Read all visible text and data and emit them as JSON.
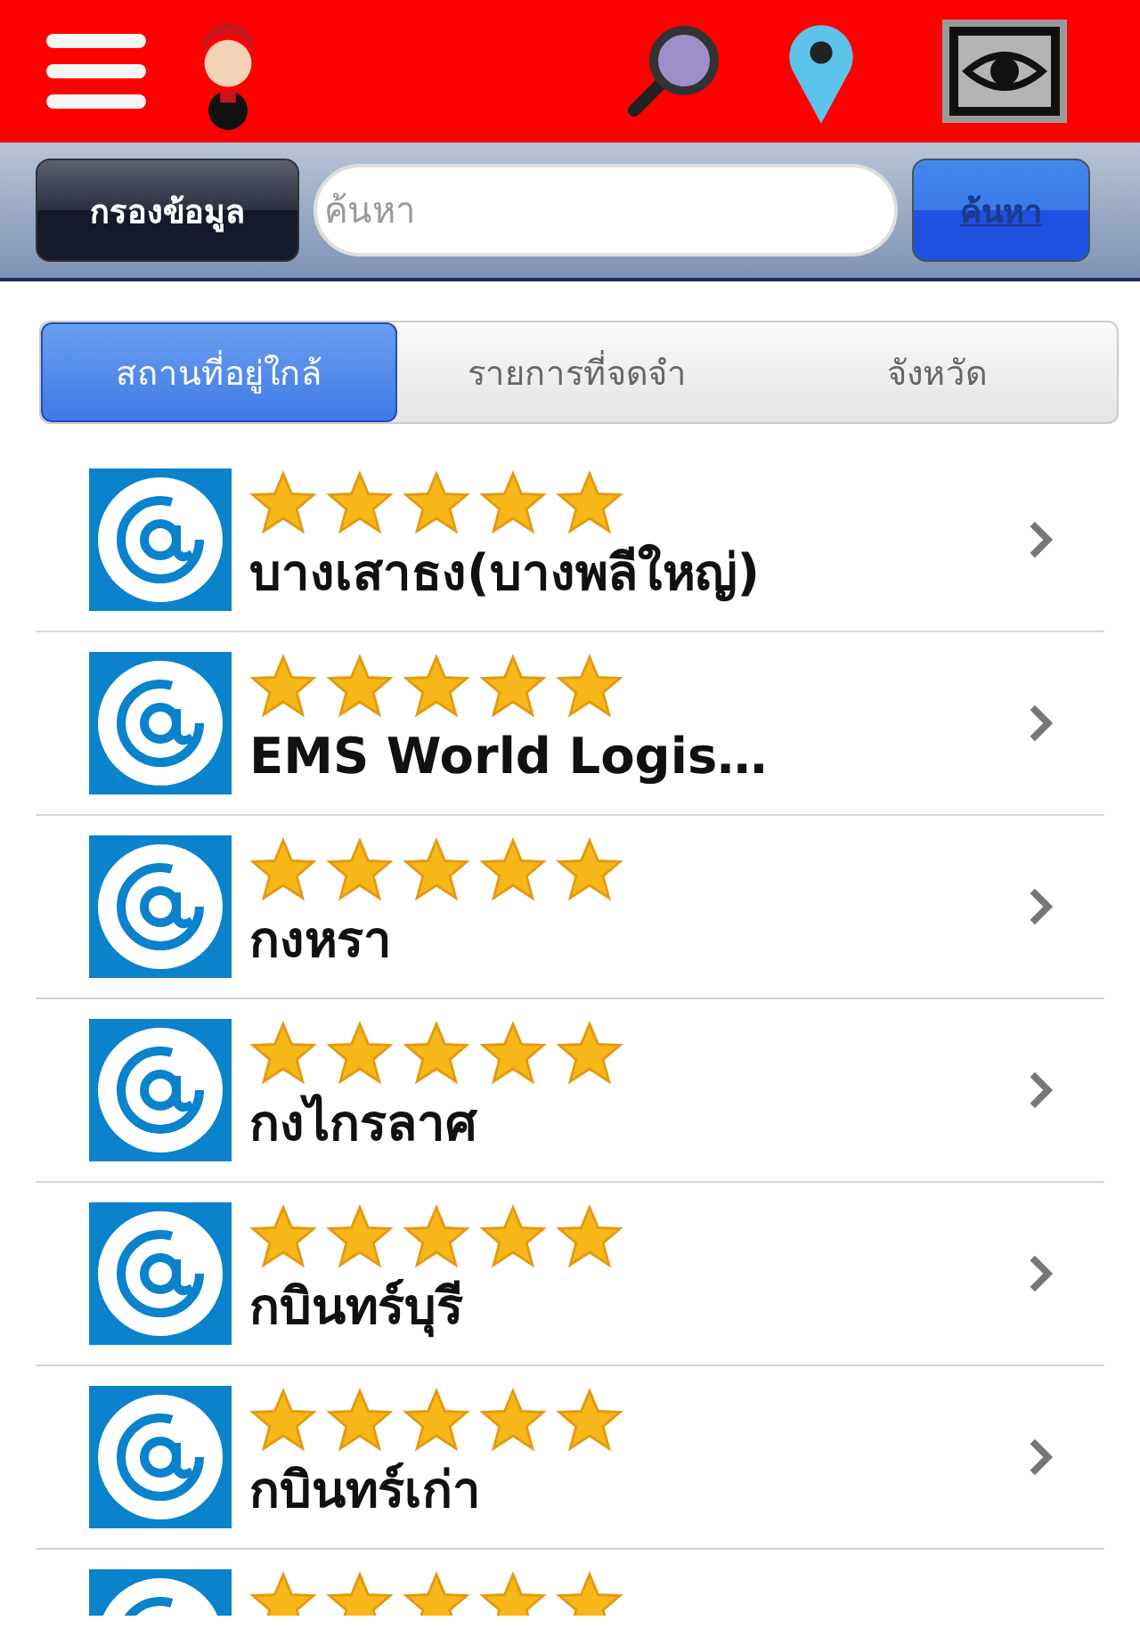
{
  "toolbar": {
    "filter_button": "กรองข้อมูล",
    "search": {
      "placeholder": "ค้นหา"
    },
    "search_button": "ค้นหา"
  },
  "tabs": [
    {
      "label": "สถานที่อยู่ใกล้",
      "selected": true
    },
    {
      "label": "รายการที่จดจำ",
      "selected": false
    },
    {
      "label": "จังหวัด",
      "selected": false
    }
  ],
  "places": [
    {
      "name": "บางเสาธง(บางพลีใหญ่)",
      "stars": 5
    },
    {
      "name": "EMS World Logis…",
      "stars": 5
    },
    {
      "name": "กงหรา",
      "stars": 5
    },
    {
      "name": "กงไกรลาศ",
      "stars": 5
    },
    {
      "name": "กบินทร์บุรี",
      "stars": 5
    },
    {
      "name": "กบินทร์เก่า",
      "stars": 5
    },
    {
      "stars": 5
    }
  ]
}
